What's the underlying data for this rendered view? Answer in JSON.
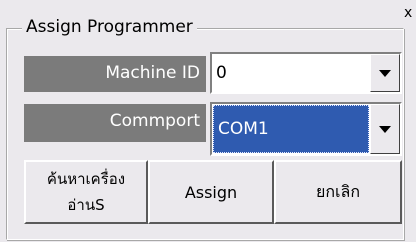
{
  "window": {
    "close_label": "x"
  },
  "group": {
    "title": "Assign Programmer"
  },
  "machine_id": {
    "label": "Machine ID",
    "value": "0"
  },
  "commport": {
    "label": "Commport",
    "value": "COM1"
  },
  "buttons": {
    "search_line1": "ค้นหาเครื่อง",
    "search_line2": "อ่านS",
    "assign": "Assign",
    "cancel": "ยกเลิก"
  },
  "colors": {
    "background": "#ebe9ed",
    "label_bg": "#7b7b7b",
    "selection": "#2f5bb0"
  },
  "icons": {
    "dropdown": "chevron-down-icon"
  }
}
